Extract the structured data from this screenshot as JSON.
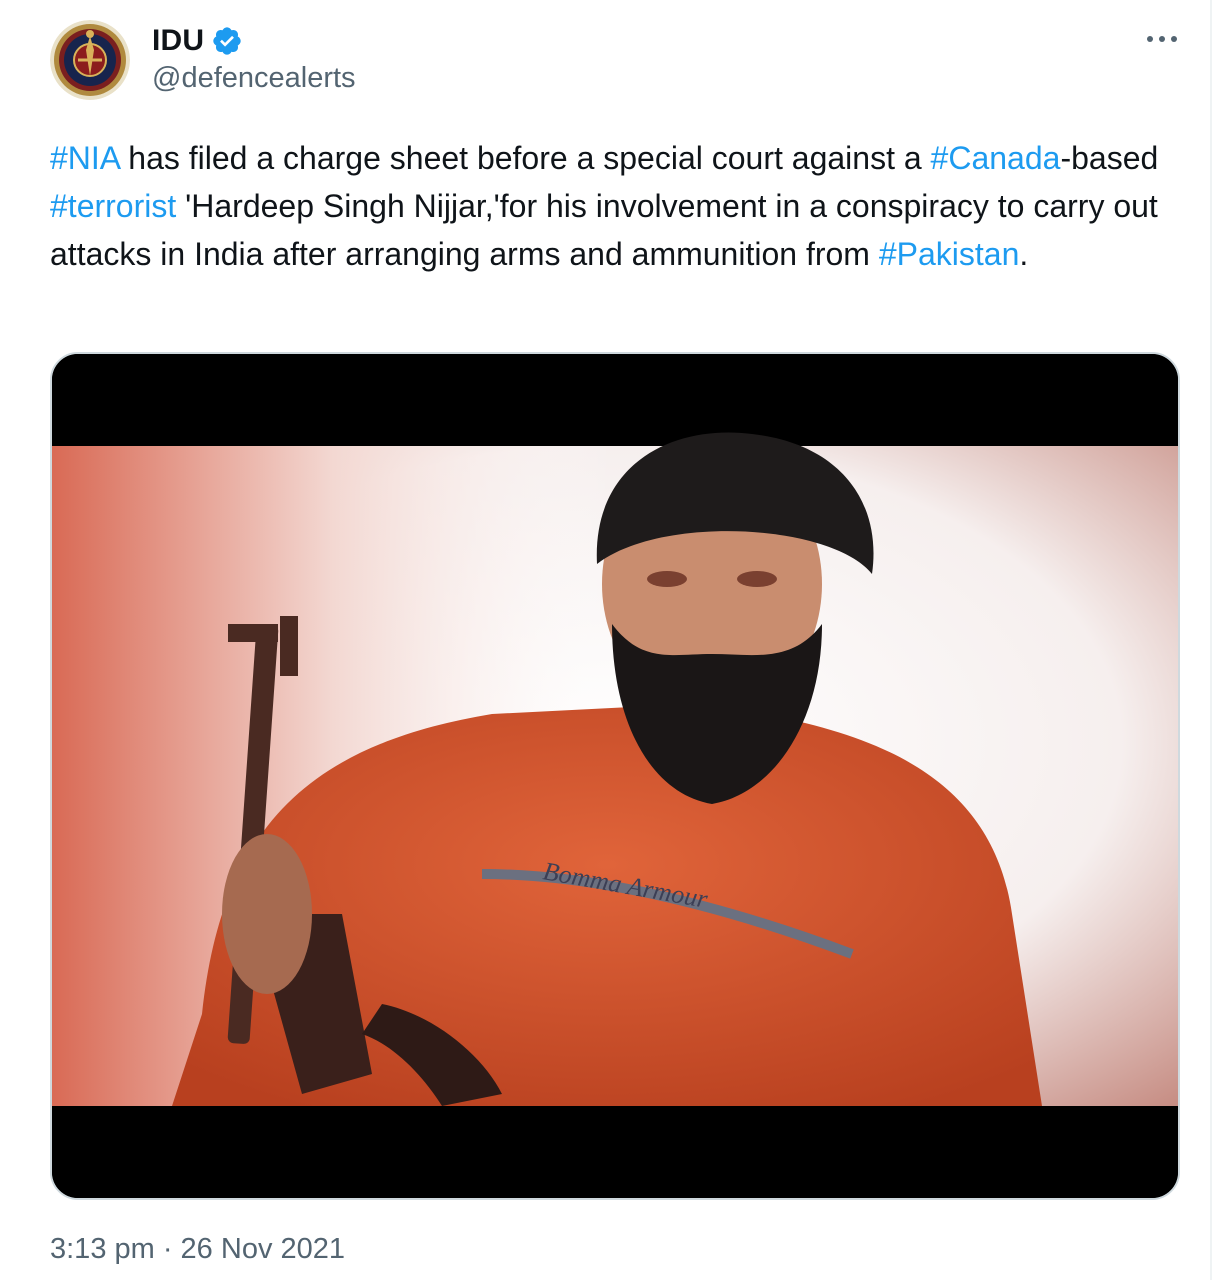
{
  "author": {
    "display_name": "IDU",
    "handle": "@defencealerts",
    "verified_icon": "verified-badge-icon",
    "avatar_icon": "idu-emblem-icon"
  },
  "menu": {
    "more_icon": "more-dots-icon"
  },
  "tweet": {
    "segments": [
      {
        "text": "#NIA",
        "hashtag": true
      },
      {
        "text": " has filed a charge sheet before a special court against a ",
        "hashtag": false
      },
      {
        "text": "#Canada",
        "hashtag": true
      },
      {
        "text": "-based ",
        "hashtag": false
      },
      {
        "text": "#terrorist",
        "hashtag": true
      },
      {
        "text": " 'Hardeep Singh Nijjar,'for his involvement in a conspiracy to carry out attacks in India after arranging arms and ammunition from ",
        "hashtag": false
      },
      {
        "text": "#Pakistan",
        "hashtag": true
      },
      {
        "text": ".",
        "hashtag": false
      }
    ],
    "image": {
      "shirt_text": "Bomma Armour"
    },
    "timestamp": "3:13 pm · 26 Nov 2021"
  },
  "colors": {
    "link": "#1d9bf0",
    "text": "#0f1419",
    "muted": "#536471",
    "verified": "#1d9bf0"
  }
}
